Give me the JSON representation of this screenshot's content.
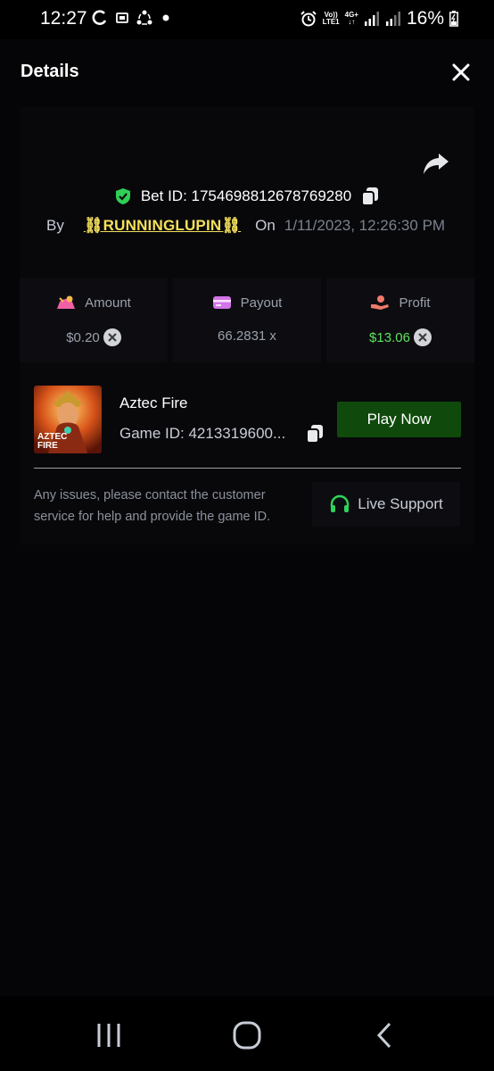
{
  "status_bar": {
    "time": "12:27",
    "network_top": "Vo))",
    "network_bottom": "LTE1",
    "network_type": "4G+",
    "battery": "16%",
    "icons": [
      "sync-icon",
      "screenshot-icon",
      "share-circle-icon",
      "dot-icon",
      "alarm-icon",
      "signal-icon",
      "battery-icon"
    ]
  },
  "header": {
    "title": "Details",
    "close_icon": "close-icon"
  },
  "bet": {
    "bet_id_label": "Bet ID: 1754698812678769280",
    "by_label": "By",
    "username": "RUNNINGLUPIN",
    "username_prefix": "⛓",
    "username_suffix": "⛓",
    "on_label": "On",
    "date": "1/11/2023, 12:26:30 PM"
  },
  "stats": {
    "amount": {
      "label": "Amount",
      "value": "$0.20"
    },
    "payout": {
      "label": "Payout",
      "value": "66.2831 x"
    },
    "profit": {
      "label": "Profit",
      "value": "$13.06"
    }
  },
  "game": {
    "name": "Aztec Fire",
    "id_label": "Game ID: 4213319600...",
    "thumb_line1": "AZTEC",
    "thumb_line2": "FIRE",
    "play_label": "Play Now"
  },
  "support": {
    "help_text": "Any issues, please contact the customer service for help and provide the game ID.",
    "button_label": "Live Support"
  },
  "colors": {
    "background": "#050507",
    "username": "#f5e15a",
    "profit": "#5be45b",
    "play_button": "#0f4a0c",
    "shield": "#2fcf55"
  }
}
